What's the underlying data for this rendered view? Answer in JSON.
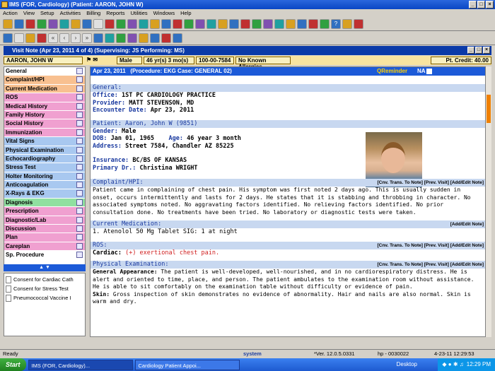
{
  "app": {
    "title": "IMS (FOR, Cardiology)     (Patient: AARON, JOHN W)"
  },
  "menu": [
    "Action",
    "View",
    "Setup",
    "Activities",
    "Billing",
    "Reports",
    "Utilities",
    "Windows",
    "Help"
  ],
  "visit": {
    "title": "Visit Note (Apr 23, 2011    4 of 4) (Supervising: JS Performing: MS)"
  },
  "patientbar": {
    "name": "AARON, JOHN W",
    "gender": "Male",
    "age": "46 yr(s) 3 mo(s)",
    "id": "100-00-7584",
    "allergy": "No Known Allergies",
    "credit": "Pt. Credit:  40.00"
  },
  "nav": [
    {
      "label": "General",
      "c": "w"
    },
    {
      "label": "Complaint/HPI",
      "c": "o"
    },
    {
      "label": "Current Medication",
      "c": "o"
    },
    {
      "label": "ROS",
      "c": "p"
    },
    {
      "label": "Medical History",
      "c": "p"
    },
    {
      "label": "Family History",
      "c": "p"
    },
    {
      "label": "Social History",
      "c": "p"
    },
    {
      "label": "Immunization",
      "c": "p"
    },
    {
      "label": "Vital Signs",
      "c": "b"
    },
    {
      "label": "Physical Examination",
      "c": "b"
    },
    {
      "label": "Echocardiography",
      "c": "b"
    },
    {
      "label": "Stress Test",
      "c": "b"
    },
    {
      "label": "Holter Monitoring",
      "c": "b"
    },
    {
      "label": "Anticoagulation",
      "c": "b"
    },
    {
      "label": "X-Rays & EKG",
      "c": "b"
    },
    {
      "label": "Diagnosis",
      "c": "g"
    },
    {
      "label": "Prescription",
      "c": "p"
    },
    {
      "label": "Diagnostic/Lab",
      "c": "p"
    },
    {
      "label": "Discussion",
      "c": "p"
    },
    {
      "label": "Plan",
      "c": "p"
    },
    {
      "label": "Careplan",
      "c": "p"
    },
    {
      "label": "Sp. Procedure",
      "c": "w"
    }
  ],
  "docs": [
    "Consent for Cardiac Cath",
    "Consent for Stress Test",
    "Pneumococcal Vaccine I"
  ],
  "header": {
    "date": "Apr 23, 2011",
    "procedure": "(Procedure:  EKG  Case: GENERAL 02)",
    "qr": "QReminder",
    "na": "NA"
  },
  "general": {
    "title": "General:",
    "office_l": "Office:",
    "office": "1ST PC CARDIOLOGY PRACTICE",
    "provider_l": "Provider:",
    "provider": "MATT STEVENSON, MD",
    "enc_l": "Encounter Date:",
    "enc": "Apr 23, 2011"
  },
  "patient": {
    "title": "Patient: Aaron, John W  (9851)",
    "gender_l": "Gender:",
    "gender": "Male",
    "dob_l": "DOB:",
    "dob": "Jan 01, 1965",
    "age_l": "Age:",
    "age": "46 year 3 month",
    "addr_l": "Address:",
    "addr": "Street 7584, Chandler AZ 85225",
    "ins_l": "Insurance:",
    "ins": "BC/BS OF KANSAS",
    "pdr_l": "Primary Dr.:",
    "pdr": "Christina WRIGHT"
  },
  "complaint": {
    "title": "Complaint/HPI:",
    "a1": "[Cnv. Trans. To Note]",
    "a2": "[Prev. Visit]",
    "a3": "[Add/Edit Note]",
    "text": "Patient came in complaining of chest pain. His symptom was first noted 2 days ago. This is usually sudden in onset, occurs intermittently and lasts for 2 days. He states that it is stabbing and throbbing in character. No associated symptoms noted. No aggravating factors identified. No relieving factors identified. No prior consultation done. No treatments have been tried. No laboratory or diagnostic tests were taken."
  },
  "meds": {
    "title": "Current Medication:",
    "a1": "[Add/Edit Note]",
    "line": "1. Atenolol 50 Mg Tablet  SIG: 1 at night"
  },
  "ros": {
    "title": "ROS:",
    "a1": "[Cnv. Trans. To Note]",
    "a2": "[Prev. Visit]",
    "a3": "[Add/Edit Note]",
    "label": "Cardiac:",
    "value": "(+) exertional chest pain."
  },
  "pe": {
    "title": "Physical Examination:",
    "a1": "[Cnv. Trans. To Note]",
    "a2": "[Prev. Visit]",
    "a3": "[Add/Edit Note]",
    "ga_l": "General Appearance:",
    "ga": "The patient is well-developed, well-nourished, and in no cardiorespiratory distress. He is alert and oriented to time, place, and person. The patient ambulates to the examination room without assistance. He is able to sit comfortably on the examination table without difficulty or evidence of pain.",
    "skin_l": "Skin:",
    "skin": "Gross inspection of skin demonstrates no evidence of abnormality. Hair and nails are also normal. Skin is warm and dry."
  },
  "status": {
    "ready": "Ready",
    "system": "system",
    "ver": "*Ver. 12.0.5.0331",
    "host": "hp - 0030022",
    "datetime": "4-23-11 12:29:53"
  },
  "taskbar": {
    "start": "Start",
    "t1": "IMS (FOR, Cardiology)...",
    "t2": "Cardiology Patient Appoi...",
    "desktop": "Desktop",
    "time": "12:29 PM"
  }
}
